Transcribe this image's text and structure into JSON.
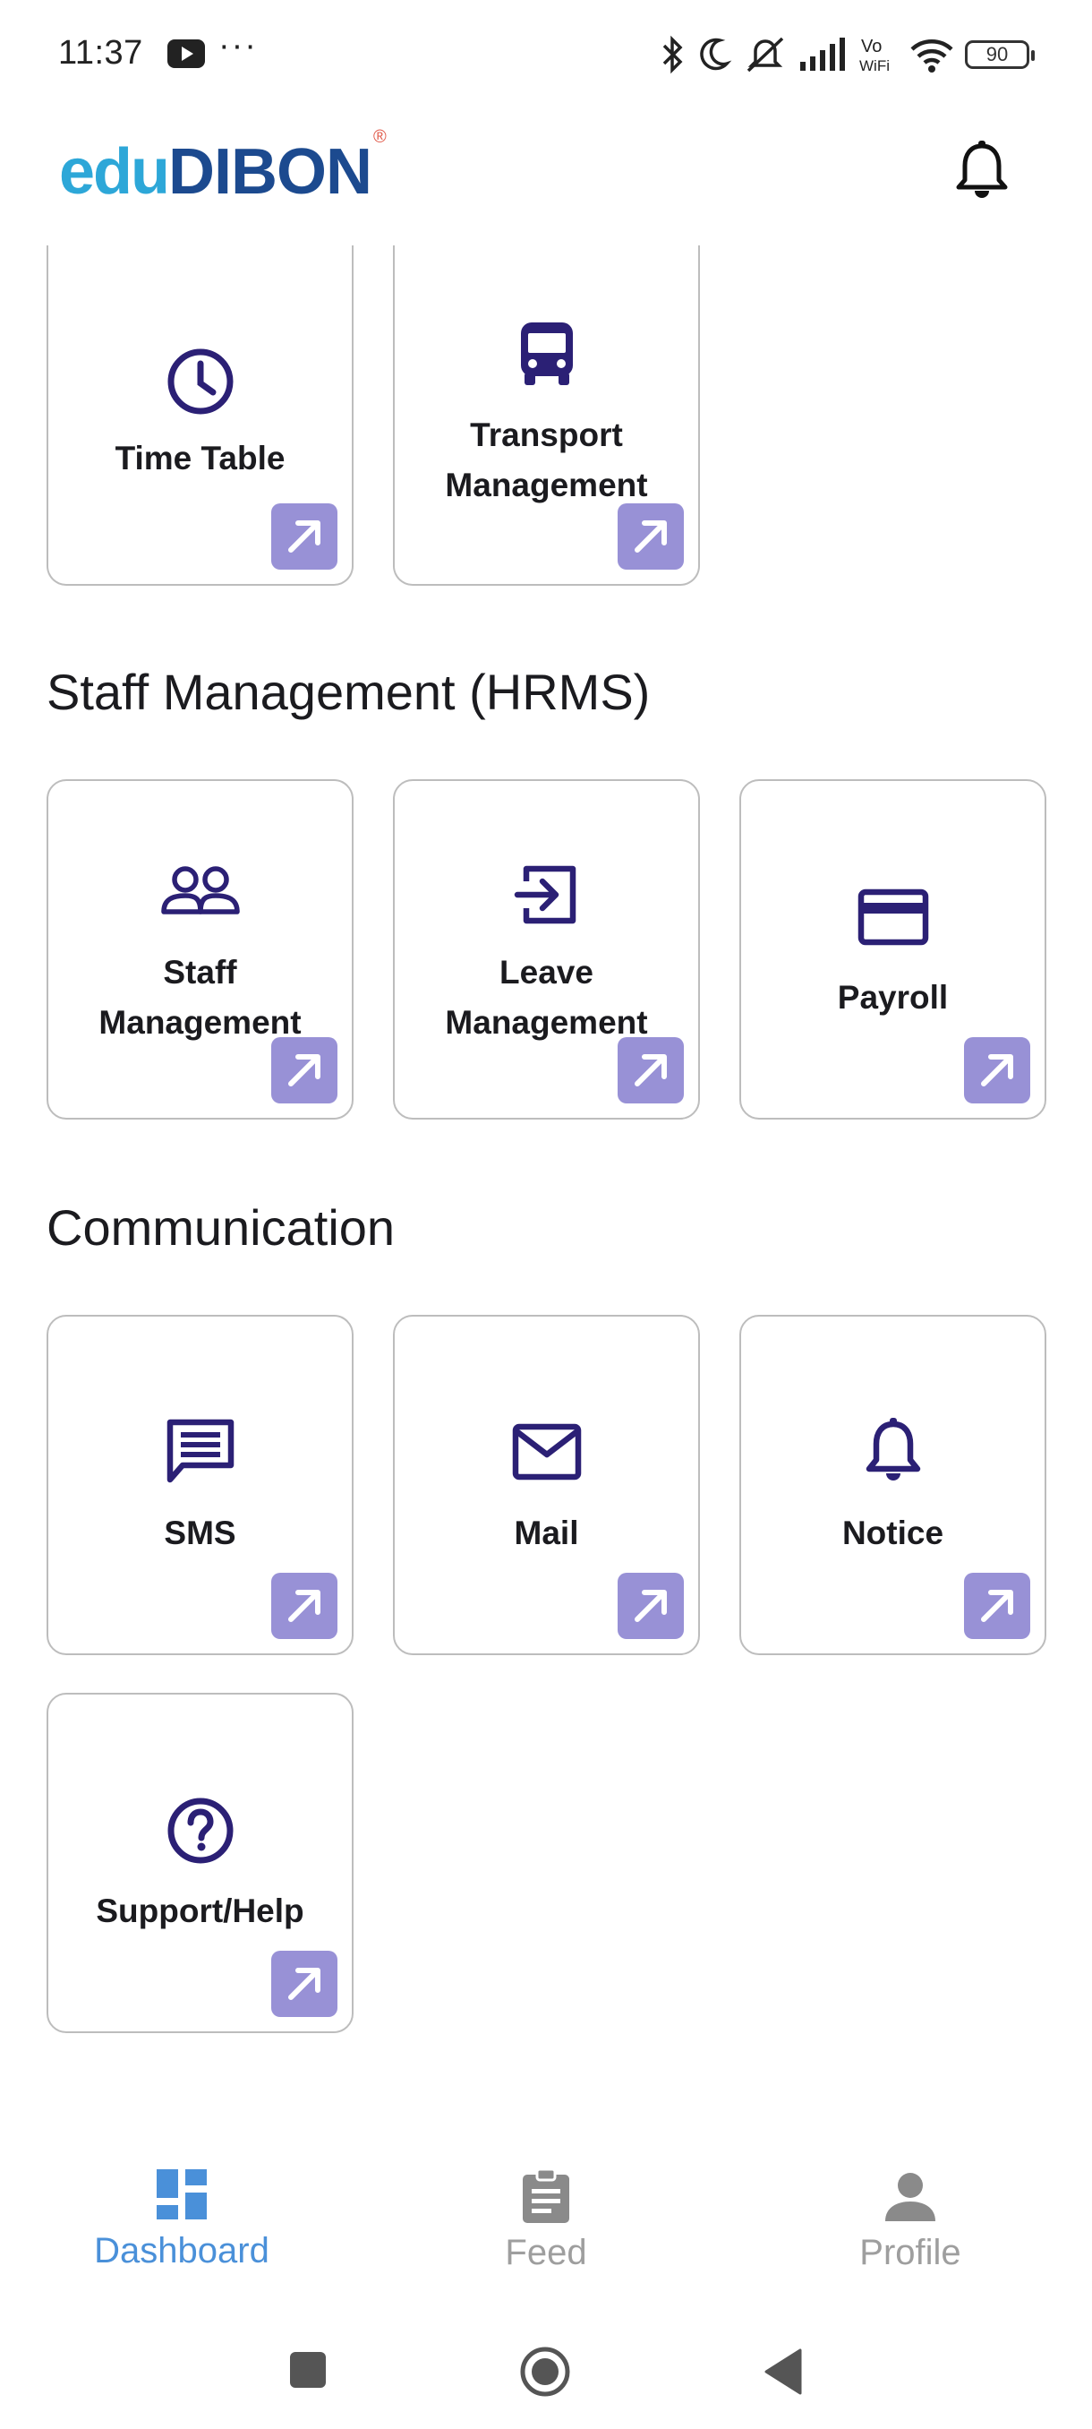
{
  "status_bar": {
    "time": "11:37",
    "more": "···",
    "battery": "90",
    "icons": [
      "youtube-icon",
      "bluetooth-icon",
      "moon-icon",
      "mute-icon",
      "signal-icon",
      "vowifi-icon",
      "wifi-icon",
      "battery-icon"
    ]
  },
  "app_bar": {
    "logo_part1": "edu",
    "logo_part2": "DIBON",
    "logo_reg": "®",
    "notification_icon": "bell-icon"
  },
  "sections": [
    {
      "title": "",
      "cards": [
        {
          "line1": "Time Table",
          "line2": "",
          "icon": "clock-icon"
        },
        {
          "line1": "Transport",
          "line2": "Management",
          "icon": "bus-icon"
        }
      ]
    },
    {
      "title": "Staff Management (HRMS)",
      "cards": [
        {
          "line1": "Staff",
          "line2": "Management",
          "icon": "people-icon"
        },
        {
          "line1": "Leave",
          "line2": "Management",
          "icon": "login-arrow-icon"
        },
        {
          "line1": "Payroll",
          "line2": "",
          "icon": "credit-card-icon"
        }
      ]
    },
    {
      "title": "Communication",
      "cards": [
        {
          "line1": "SMS",
          "line2": "",
          "icon": "message-icon"
        },
        {
          "line1": "Mail",
          "line2": "",
          "icon": "mail-icon"
        },
        {
          "line1": "Notice",
          "line2": "",
          "icon": "bell-icon"
        },
        {
          "line1": "Support/Help",
          "line2": "",
          "icon": "help-circle-icon"
        }
      ]
    }
  ],
  "bottom_nav": {
    "items": [
      {
        "label": "Dashboard",
        "icon": "dashboard-icon",
        "active": true
      },
      {
        "label": "Feed",
        "icon": "clipboard-icon",
        "active": false
      },
      {
        "label": "Profile",
        "icon": "person-icon",
        "active": false
      }
    ]
  },
  "colors": {
    "icon_purple": "#2b2075",
    "arrow_button": "#9891d6",
    "nav_active": "#4a90d9",
    "nav_inactive": "#9e9e9e"
  }
}
